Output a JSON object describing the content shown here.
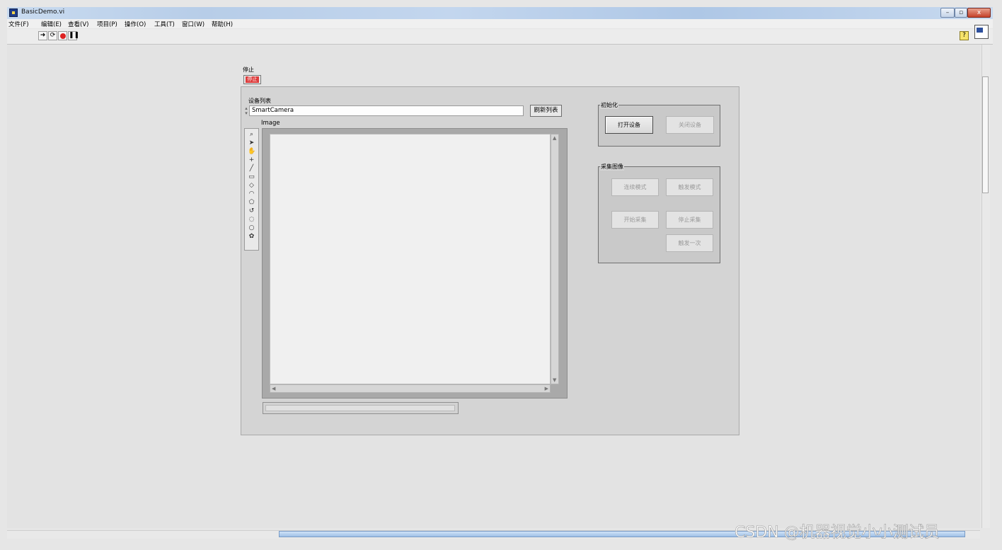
{
  "window": {
    "title": "BasicDemo.vi",
    "controls": {
      "minimize": "–",
      "maximize": "▫",
      "close": "x"
    }
  },
  "menu": [
    "文件(F)",
    "编辑(E)",
    "查看(V)",
    "项目(P)",
    "操作(O)",
    "工具(T)",
    "窗口(W)",
    "帮助(H)"
  ],
  "toolbar": {
    "run_icon": "run-arrow-icon",
    "run_continuous_icon": "run-continuously-icon",
    "abort_icon": "abort-execution-icon",
    "pause_icon": "pause-icon",
    "help_label": "?"
  },
  "front_panel": {
    "stop": {
      "caption": "停止",
      "label": "停止"
    },
    "device_list": {
      "caption": "设备列表",
      "value": "SmartCamera",
      "refresh_label": "刷新列表"
    },
    "image": {
      "caption": "Image"
    },
    "init_group": {
      "label": "初始化",
      "open_label": "打开设备",
      "close_label": "关闭设备"
    },
    "capture_group": {
      "label": "采集图像",
      "continuous_label": "连续模式",
      "trigger_mode_label": "触发模式",
      "start_label": "开始采集",
      "stop_label": "停止采集",
      "trigger_once_label": "触发一次"
    }
  },
  "watermark": "CSDN @机器视觉小小测试员",
  "colors": {
    "stop_red": "#dd3c3c",
    "panel_bg": "#e3e3e3",
    "titlebar": "#c3d6ee"
  }
}
